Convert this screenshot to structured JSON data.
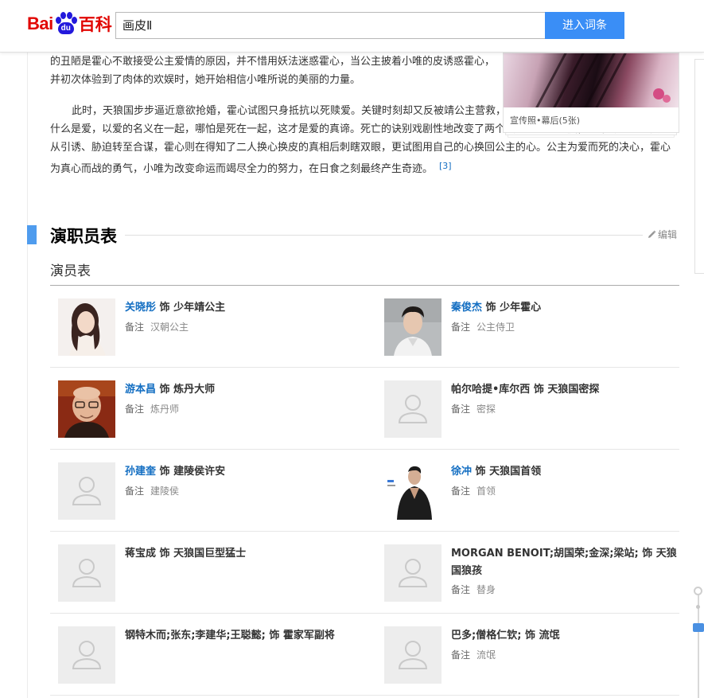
{
  "header": {
    "logo_bai": "Bai",
    "logo_du": "du",
    "logo_ke": "百科",
    "search_value": "画皮Ⅱ",
    "search_button": "进入词条"
  },
  "article": {
    "p1": "的丑陋是霍心不敢接受公主爱情的原因，并不惜用妖法迷惑霍心，当公主披着小唯的皮诱惑霍心，并初次体验到了肉体的欢娱时，她开始相信小唯所说的美丽的力量。",
    "p2": "此时，天狼国步步逼近意欲抢婚，霍心试图只身抵抗以死赎爱。关键时刻却又反被靖公主营救，这一切极大的刺激了霍心。他明白了什么是爱，以爱的名义在一起，哪怕是死在一起，这才是爱的真谛。死亡的诀别戏剧性地改变了两个女人的人生态度，小唯与公主的关系从引诱、胁迫转至合谋，霍心则在得知了二人换心换皮的真相后刺瞎双眼，更试图用自己的心换回公主的心。公主为爱而死的决心，霍心为真心而战的勇气，小唯为改变命运而竭尽全力的努力，在日食之刻最终产生奇迹。",
    "citation": "[3]"
  },
  "figure": {
    "caption": "宣传照•幕后(5张)"
  },
  "section": {
    "title": "演职员表",
    "edit": "编辑",
    "subtitle": "演员表"
  },
  "cast": [
    [
      {
        "name": "关晓彤",
        "role": "饰 少年靖公主",
        "note_label": "备注",
        "note": "汉朝公主",
        "photo": "actress-photo"
      },
      {
        "name": "秦俊杰",
        "role": "饰 少年霍心",
        "note_label": "备注",
        "note": "公主侍卫",
        "photo": "actor-photo"
      }
    ],
    [
      {
        "name": "游本昌",
        "role": "饰 炼丹大师",
        "note_label": "备注",
        "note": "炼丹师",
        "photo": "elder-actor-photo"
      },
      {
        "name": "帕尔哈提•库尔西",
        "role": "饰 天狼国密探",
        "note_label": "备注",
        "note": "密探",
        "photo": "placeholder"
      }
    ],
    [
      {
        "name": "孙建奎",
        "role": "饰 建陵侯许安",
        "note_label": "备注",
        "note": "建陵侯",
        "photo": "placeholder"
      },
      {
        "name": "徐冲",
        "role": "饰 天狼国首领",
        "note_label": "备注",
        "note": "首领",
        "photo": "actor-photo-dark"
      }
    ],
    [
      {
        "name": "蒋宝成",
        "role": "饰 天狼国巨型猛士",
        "note_label": "",
        "note": "",
        "photo": "placeholder"
      },
      {
        "name": "MORGAN BENOIT;胡国荣;金深;梁站;",
        "role": "饰 天狼国狼孩",
        "note_label": "备注",
        "note": "替身",
        "photo": "placeholder"
      }
    ],
    [
      {
        "name": "钢特木而;张东;李建华;王聪懿;",
        "role": "饰 霍家军副将",
        "note_label": "",
        "note": "",
        "photo": "placeholder"
      },
      {
        "name": "巴多;僧格仁钦;",
        "role": "饰 流氓",
        "note_label": "备注",
        "note": "流氓",
        "photo": "placeholder"
      }
    ]
  ],
  "colors": {
    "accent": "#3a8ef6",
    "link": "#136ec2",
    "section_bar": "#4f9cee"
  }
}
